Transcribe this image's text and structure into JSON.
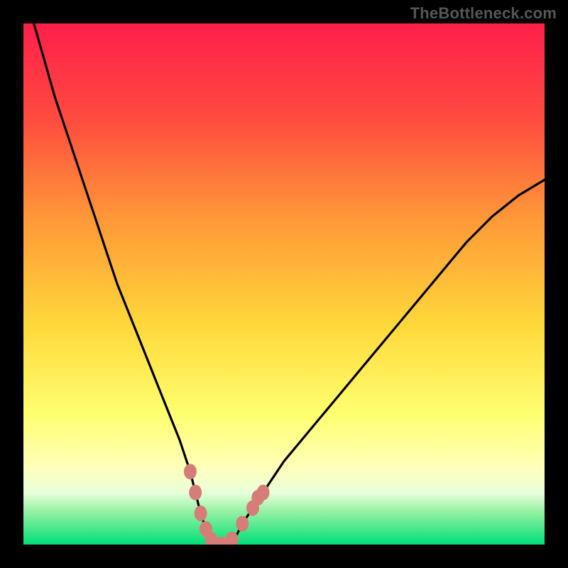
{
  "watermark": "TheBottleneck.com",
  "colors": {
    "frame": "#000000",
    "curve": "#000000",
    "markers": "#d77d79",
    "gradient_top": "#ff1f4a",
    "gradient_mid1": "#ff7a3a",
    "gradient_mid2": "#ffdc3c",
    "gradient_mid3": "#ffff84",
    "gradient_bottom_band_top": "#ffffc0",
    "gradient_bottom_band_mid": "#6fe38f",
    "gradient_bottom": "#00e07a"
  },
  "chart_data": {
    "type": "line",
    "title": "",
    "xlabel": "",
    "ylabel": "",
    "xlim": [
      0,
      100
    ],
    "ylim": [
      0,
      100
    ],
    "series": [
      {
        "name": "bottleneck-curve",
        "x": [
          2,
          4,
          6,
          8,
          10,
          12,
          14,
          16,
          18,
          20,
          22,
          24,
          26,
          28,
          30,
          31,
          32,
          33,
          34,
          35,
          36,
          37,
          38,
          39,
          40,
          41,
          42,
          44,
          46,
          50,
          55,
          60,
          65,
          70,
          75,
          80,
          85,
          90,
          95,
          100
        ],
        "y": [
          100,
          93,
          86,
          80,
          74,
          68,
          62,
          56,
          50,
          45,
          40,
          35,
          30,
          25,
          20,
          17,
          14,
          10,
          6,
          3,
          1,
          0,
          0,
          0,
          1,
          2,
          4,
          7,
          10,
          16,
          22,
          28,
          34,
          40,
          46,
          52,
          58,
          63,
          67,
          70
        ]
      }
    ],
    "markers": {
      "name": "highlighted-near-minimum",
      "points": [
        {
          "x": 32,
          "y": 14
        },
        {
          "x": 33,
          "y": 10
        },
        {
          "x": 34,
          "y": 6
        },
        {
          "x": 35,
          "y": 3
        },
        {
          "x": 36,
          "y": 1
        },
        {
          "x": 37,
          "y": 0
        },
        {
          "x": 38,
          "y": 0
        },
        {
          "x": 39,
          "y": 0
        },
        {
          "x": 40,
          "y": 1
        },
        {
          "x": 42,
          "y": 4
        },
        {
          "x": 44,
          "y": 7
        },
        {
          "x": 45,
          "y": 9
        },
        {
          "x": 46,
          "y": 10
        }
      ]
    },
    "optimum_x": 38
  }
}
